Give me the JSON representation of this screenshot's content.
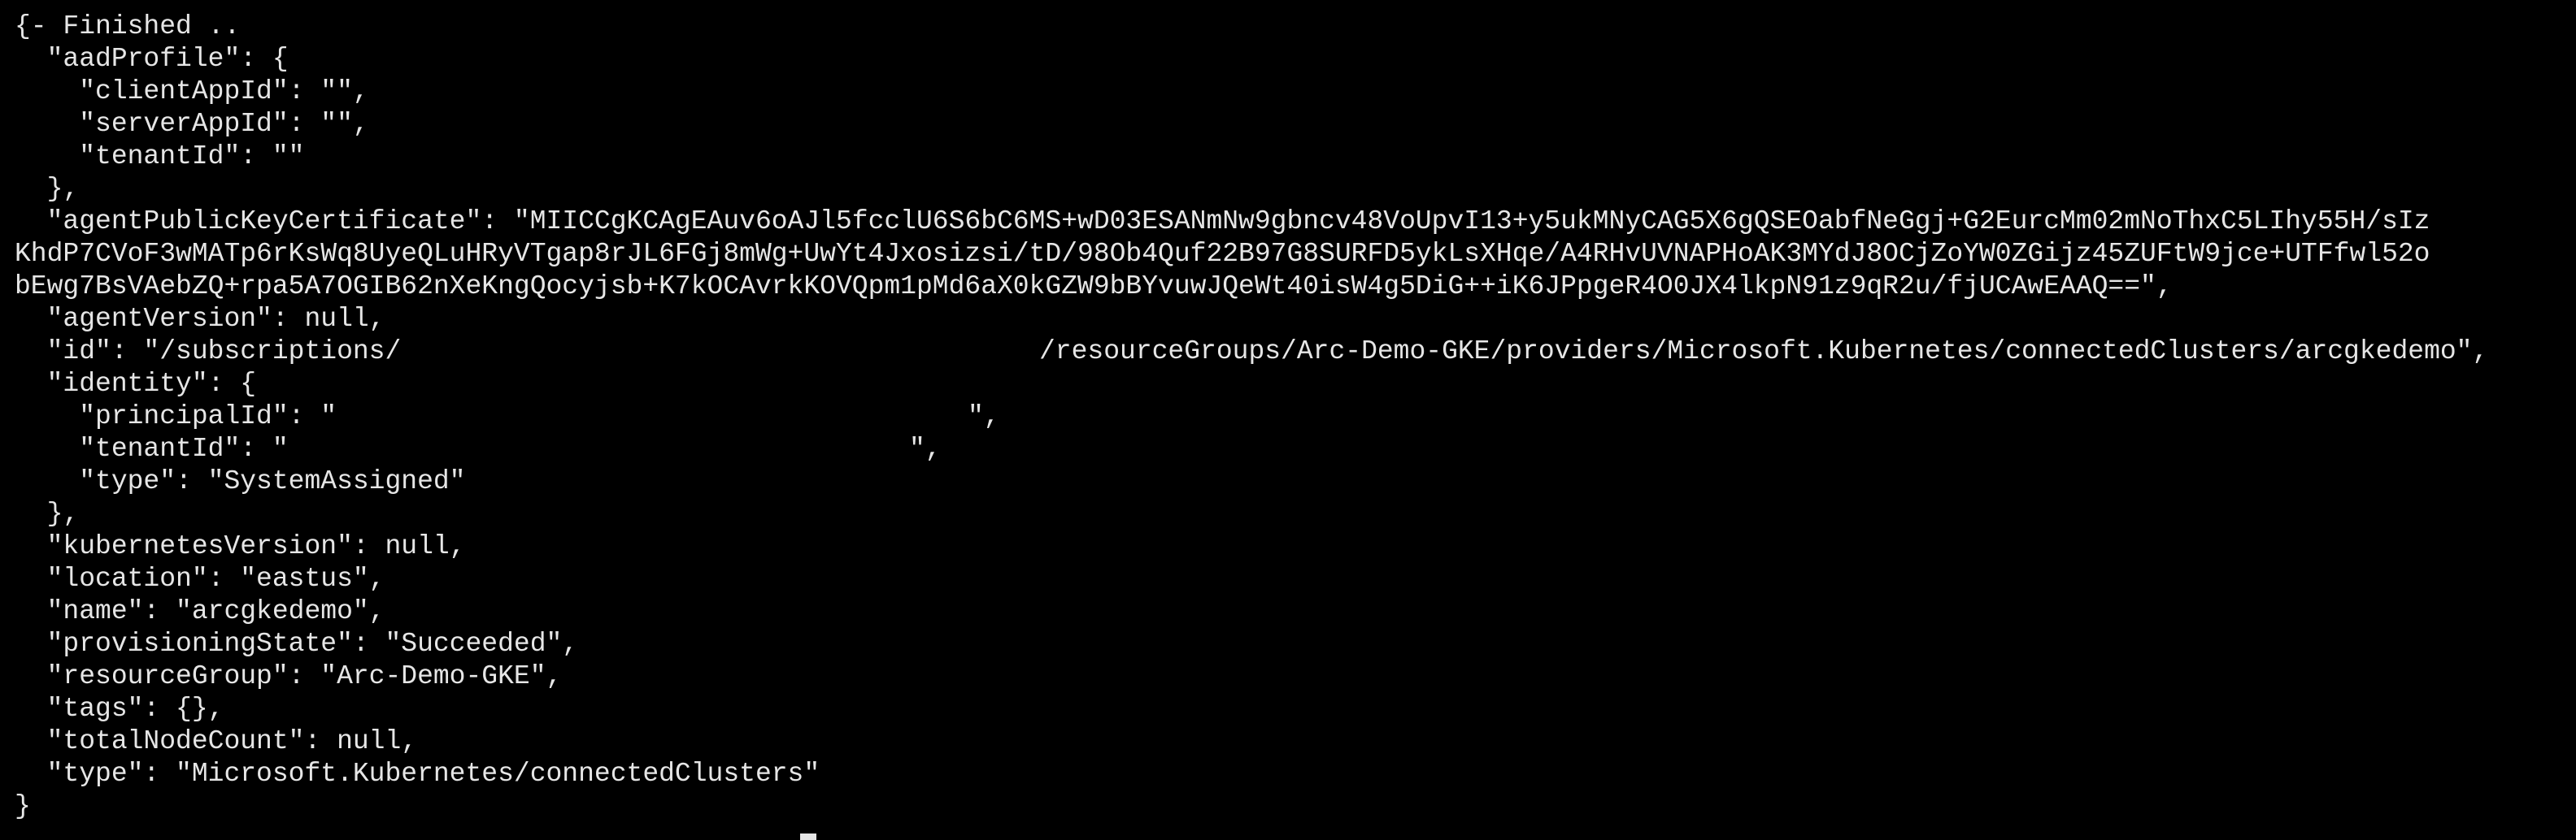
{
  "terminal": {
    "background": "#000000",
    "foreground": "#e6e6e6",
    "lines": [
      "{- Finished ..",
      "  \"aadProfile\": {",
      "    \"clientAppId\": \"\",",
      "    \"serverAppId\": \"\",",
      "    \"tenantId\": \"\"",
      "  },",
      "  \"agentPublicKeyCertificate\": \"MIICCgKCAgEAuv6oAJl5fcclU6S6bC6MS+wD03ESANmNw9gbncv48VoUpvI13+y5ukMNyCAG5X6gQSEOabfNeGgj+G2EurcMm02mNoThxC5LIhy55H/sIz",
      "KhdP7CVoF3wMATp6rKsWq8UyeQLuHRyVTgap8rJL6FGj8mWg+UwYt4Jxosizsi/tD/98Ob4Quf22B97G8SURFD5ykLsXHqe/A4RHvUVNAPHoAK3MYdJ8OCjZoYW0ZGijz45ZUFtW9jce+UTFfwl52o",
      "bEwg7BsVAebZQ+rpa5A7OGIB62nXeKngQocyjsb+K7kOCAvrkKOVQpm1pMd6aX0kGZW9bBYvuwJQeWt40isW4g5DiG++iK6JPpgeR4O0JX4lkpN91z9qR2u/fjUCAwEAAQ==\",",
      "  \"agentVersion\": null,",
      "  \"id\": \"/subscriptions/",
      "/resourceGroups/Arc-Demo-GKE/providers/Microsoft.Kubernetes/connectedClusters/arcgkedemo\",",
      "  \"identity\": {",
      "    \"principalId\": \"",
      "\",",
      "    \"tenantId\": \"",
      "\",",
      "    \"type\": \"SystemAssigned\"",
      "  },",
      "  \"kubernetesVersion\": null,",
      "  \"location\": \"eastus\",",
      "  \"name\": \"arcgkedemo\",",
      "  \"provisioningState\": \"Succeeded\",",
      "  \"resourceGroup\": \"Arc-Demo-GKE\",",
      "  \"tags\": {},",
      "  \"totalNodeCount\": null,",
      "  \"type\": \"Microsoft.Kubernetes/connectedClusters\"",
      "}"
    ]
  }
}
